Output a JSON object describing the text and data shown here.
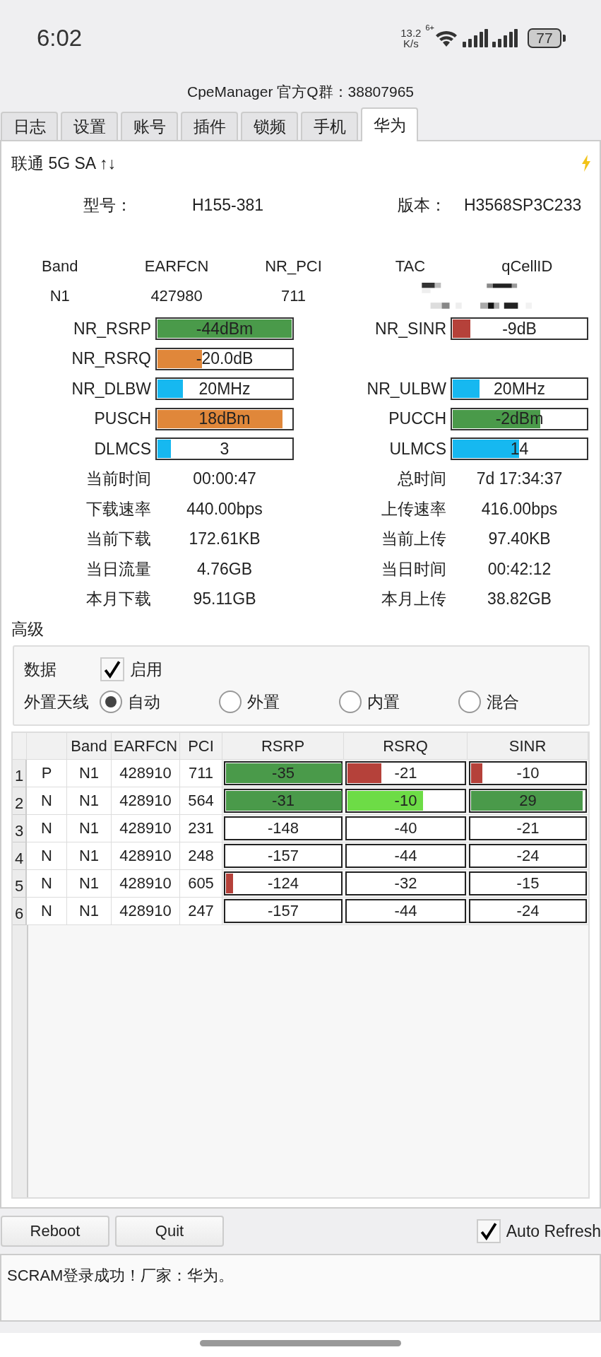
{
  "status_bar": {
    "time": "6:02",
    "speed": "13.2",
    "speed_unit": "K/s",
    "wifi_badge": "6+",
    "battery": "77"
  },
  "title": "CpeManager 官方Q群：38807965",
  "tabs": [
    {
      "label": "日志",
      "selected": false
    },
    {
      "label": "设置",
      "selected": false
    },
    {
      "label": "账号",
      "selected": false
    },
    {
      "label": "插件",
      "selected": false
    },
    {
      "label": "锁频",
      "selected": false
    },
    {
      "label": "手机",
      "selected": false
    },
    {
      "label": "华为",
      "selected": true
    }
  ],
  "network": "联通 5G SA ↑↓",
  "device": [
    {
      "label": "型号：",
      "value": "H155-381"
    },
    {
      "label": "版本：",
      "value": "H3568SP3C233"
    }
  ],
  "cell_info": {
    "columns": [
      "Band",
      "EARFCN",
      "NR_PCI",
      "TAC",
      "qCellID"
    ],
    "values": [
      "N1",
      "427980",
      "711"
    ]
  },
  "metrics": [
    {
      "left": {
        "kind": "bar",
        "label": "NR_RSRP",
        "value": "-44dBm",
        "level": 0.99,
        "color": "#4a9a4a"
      },
      "right": {
        "kind": "bar",
        "label": "NR_SINR",
        "value": "-9dB",
        "level": 0.13,
        "color": "#b5413a"
      }
    },
    {
      "left": {
        "kind": "bar",
        "label": "NR_RSRQ",
        "value": "-20.0dB",
        "level": 0.33,
        "color": "#e0873a"
      }
    },
    {
      "left": {
        "kind": "bar",
        "label": "NR_DLBW",
        "value": "20MHz",
        "level": 0.19,
        "color": "#16b8f0"
      },
      "right": {
        "kind": "bar",
        "label": "NR_ULBW",
        "value": "20MHz",
        "level": 0.2,
        "color": "#16b8f0"
      }
    },
    {
      "left": {
        "kind": "bar",
        "label": "PUSCH",
        "value": "18dBm",
        "level": 0.92,
        "color": "#e0873a"
      },
      "right": {
        "kind": "bar",
        "label": "PUCCH",
        "value": "-2dBm",
        "level": 0.65,
        "color": "#4a9a4a"
      }
    },
    {
      "left": {
        "kind": "bar",
        "label": "DLMCS",
        "value": "3",
        "level": 0.1,
        "color": "#16b8f0"
      },
      "right": {
        "kind": "bar",
        "label": "ULMCS",
        "value": "14",
        "level": 0.49,
        "color": "#16b8f0"
      }
    },
    {
      "left": {
        "kind": "text",
        "label": "当前时间",
        "value": "00:00:47"
      },
      "right": {
        "kind": "text",
        "label": "总时间",
        "value": "7d 17:34:37"
      }
    },
    {
      "left": {
        "kind": "text",
        "label": "下载速率",
        "value": "440.00bps"
      },
      "right": {
        "kind": "text",
        "label": "上传速率",
        "value": "416.00bps"
      }
    },
    {
      "left": {
        "kind": "text",
        "label": "当前下载",
        "value": "172.61KB"
      },
      "right": {
        "kind": "text",
        "label": "当前上传",
        "value": "97.40KB"
      }
    },
    {
      "left": {
        "kind": "text",
        "label": "当日流量",
        "value": "4.76GB"
      },
      "right": {
        "kind": "text",
        "label": "当日时间",
        "value": "00:42:12"
      }
    },
    {
      "left": {
        "kind": "text",
        "label": "本月下载",
        "value": "95.11GB"
      },
      "right": {
        "kind": "text",
        "label": "本月上传",
        "value": "38.82GB"
      }
    }
  ],
  "advanced": {
    "title": "高级",
    "data_label": "数据",
    "data_checkbox": {
      "label": "启用",
      "checked": true
    },
    "antenna_label": "外置天线",
    "antenna_options": [
      {
        "label": "自动",
        "selected": true
      },
      {
        "label": "外置",
        "selected": false
      },
      {
        "label": "内置",
        "selected": false
      },
      {
        "label": "混合",
        "selected": false
      }
    ]
  },
  "neighbors": {
    "columns": [
      "Band",
      "EARFCN",
      "PCI",
      "RSRP",
      "RSRQ",
      "SINR"
    ],
    "rows": [
      {
        "index": "1",
        "type": "P",
        "band": "N1",
        "earfcn": "428910",
        "pci": "711",
        "signals": [
          {
            "text": "-35",
            "level": 1,
            "color": "#4a9a4a"
          },
          {
            "text": "-21",
            "level": 0.29,
            "color": "#b5413a"
          },
          {
            "text": "-10",
            "level": 0.1,
            "color": "#b5413a"
          }
        ]
      },
      {
        "index": "2",
        "type": "N",
        "band": "N1",
        "earfcn": "428910",
        "pci": "564",
        "signals": [
          {
            "text": "-31",
            "level": 1,
            "color": "#4a9a4a"
          },
          {
            "text": "-10",
            "level": 0.64,
            "color": "#6ddc46"
          },
          {
            "text": "29",
            "level": 0.97,
            "color": "#4a9a4a"
          }
        ]
      },
      {
        "index": "3",
        "type": "N",
        "band": "N1",
        "earfcn": "428910",
        "pci": "231",
        "signals": [
          {
            "text": "-148",
            "level": 0
          },
          {
            "text": "-40",
            "level": 0
          },
          {
            "text": "-21",
            "level": 0
          }
        ]
      },
      {
        "index": "4",
        "type": "N",
        "band": "N1",
        "earfcn": "428910",
        "pci": "248",
        "signals": [
          {
            "text": "-157",
            "level": 0
          },
          {
            "text": "-44",
            "level": 0
          },
          {
            "text": "-24",
            "level": 0
          }
        ]
      },
      {
        "index": "5",
        "type": "N",
        "band": "N1",
        "earfcn": "428910",
        "pci": "605",
        "signals": [
          {
            "text": "-124",
            "level": 0.06,
            "color": "#b5413a"
          },
          {
            "text": "-32",
            "level": 0
          },
          {
            "text": "-15",
            "level": 0
          }
        ]
      },
      {
        "index": "6",
        "type": "N",
        "band": "N1",
        "earfcn": "428910",
        "pci": "247",
        "signals": [
          {
            "text": "-157",
            "level": 0
          },
          {
            "text": "-44",
            "level": 0
          },
          {
            "text": "-24",
            "level": 0
          }
        ]
      }
    ]
  },
  "buttons": [
    "Reboot",
    "Quit"
  ],
  "auto_refresh": {
    "label": "Auto Refresh",
    "checked": true
  },
  "log": "SCRAM登录成功！厂家：华为。"
}
